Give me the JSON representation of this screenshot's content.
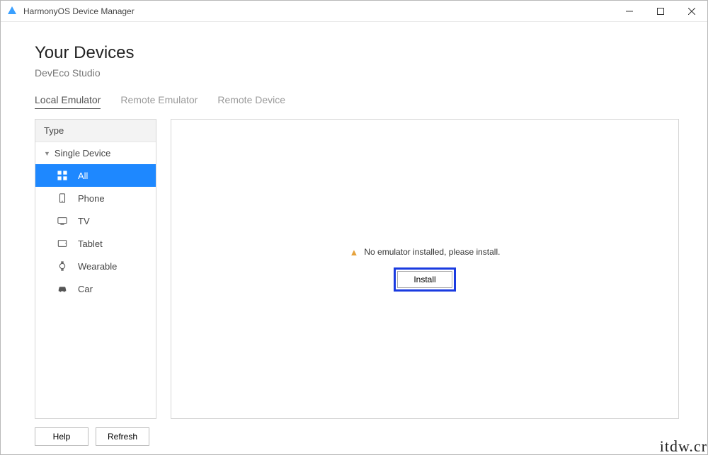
{
  "window": {
    "title": "HarmonyOS Device Manager"
  },
  "page": {
    "title": "Your Devices",
    "subtitle": "DevEco Studio"
  },
  "tabs": [
    {
      "label": "Local Emulator",
      "active": true
    },
    {
      "label": "Remote Emulator",
      "active": false
    },
    {
      "label": "Remote Device",
      "active": false
    }
  ],
  "sidebar": {
    "header": "Type",
    "group": "Single Device",
    "items": [
      {
        "label": "All",
        "icon": "grid-icon",
        "active": true
      },
      {
        "label": "Phone",
        "icon": "phone-icon",
        "active": false
      },
      {
        "label": "TV",
        "icon": "tv-icon",
        "active": false
      },
      {
        "label": "Tablet",
        "icon": "tablet-icon",
        "active": false
      },
      {
        "label": "Wearable",
        "icon": "watch-icon",
        "active": false
      },
      {
        "label": "Car",
        "icon": "car-icon",
        "active": false
      }
    ]
  },
  "main": {
    "empty_text": "No emulator installed, please install.",
    "install_label": "Install"
  },
  "footer": {
    "help": "Help",
    "refresh": "Refresh"
  },
  "watermark": "itdw.cr",
  "colors": {
    "accent": "#1e88ff",
    "highlight_border": "#1a3be0"
  }
}
